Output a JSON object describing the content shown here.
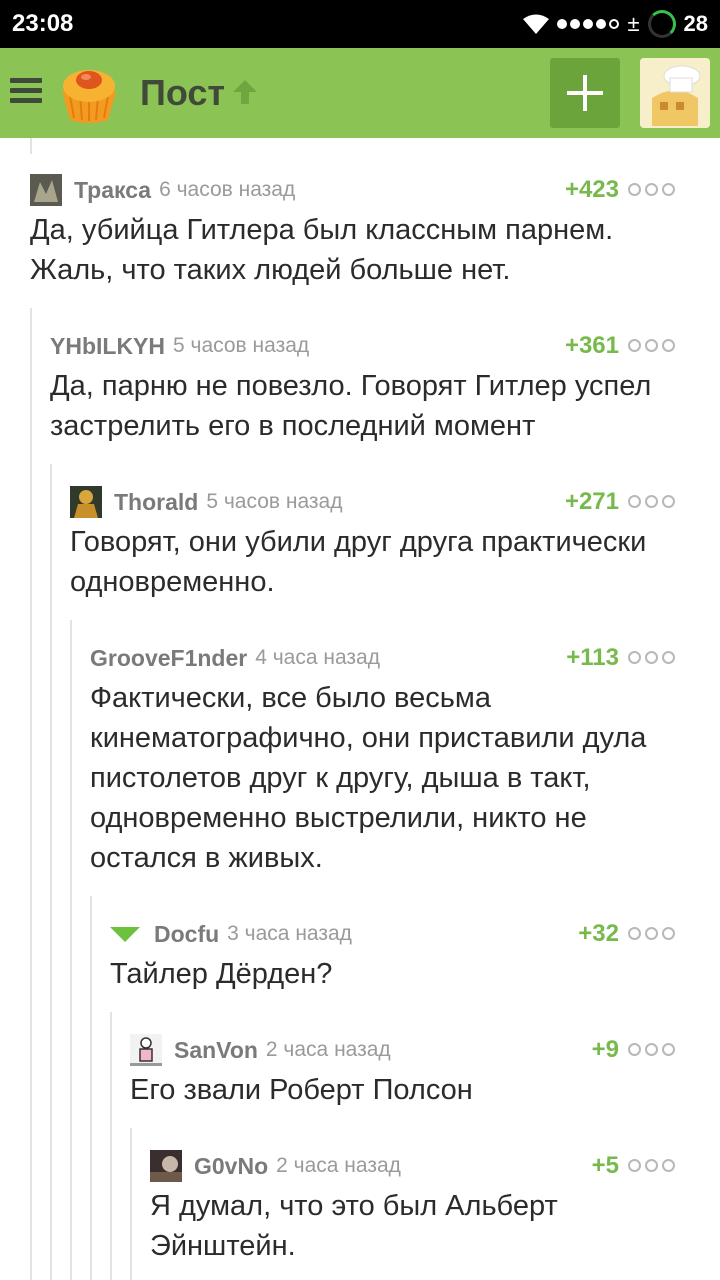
{
  "status_bar": {
    "time": "23:08",
    "battery": "28",
    "data_indicator": "±"
  },
  "app_bar": {
    "title": "Пост"
  },
  "comments": [
    {
      "author": "Тракса",
      "time": "6 часов назад",
      "score": "+423",
      "text": "Да, убийца Гитлера был классным парнем. Жаль, что таких людей больше нет."
    },
    {
      "author": "YHbILKYH",
      "time": "5 часов назад",
      "score": "+361",
      "text": "Да, парню не повезло. Говорят Гитлер успел застрелить его в последний момент"
    },
    {
      "author": "Thorald",
      "time": "5 часов назад",
      "score": "+271",
      "text": "Говорят, они убили друг друга практически одновременно."
    },
    {
      "author": "GrooveF1nder",
      "time": "4 часа назад",
      "score": "+113",
      "text": "Фактически, все было весьма кинематографично, они приставили дула пистолетов друг к другу, дыша в такт, одновременно выстрелили, никто не остался в живых."
    },
    {
      "author": "Docfu",
      "time": "3 часа назад",
      "score": "+32",
      "text": "Тайлер Дёрден?"
    },
    {
      "author": "SanVon",
      "time": "2 часа назад",
      "score": "+9",
      "text": "Его звали Роберт Полсон"
    },
    {
      "author": "G0vNo",
      "time": "2 часа назад",
      "score": "+5",
      "text": "Я думал, что это был Альберт Эйнштейн."
    }
  ]
}
